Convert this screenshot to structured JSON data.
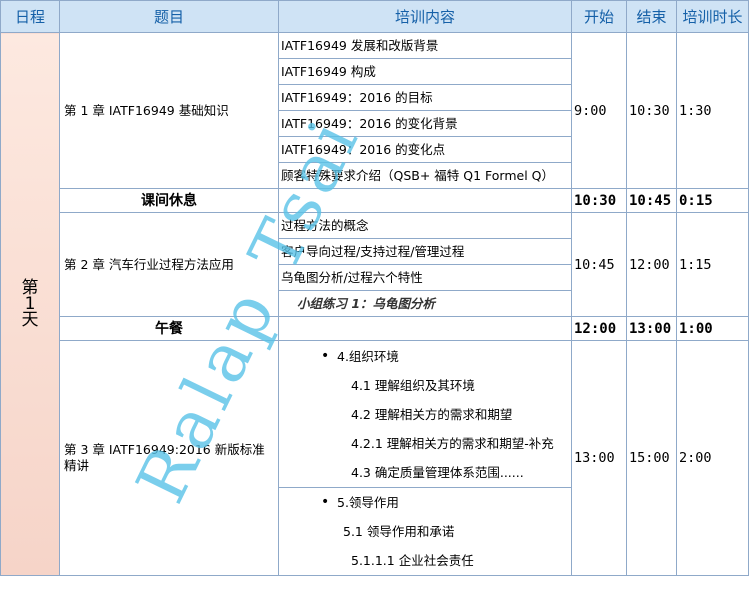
{
  "headers": [
    "日程",
    "题目",
    "培训内容",
    "开始",
    "结束",
    "培训时长"
  ],
  "day": {
    "line1": "第",
    "line2": "1",
    "line3": "天"
  },
  "ch1": {
    "topic": "第 1 章  IATF16949 基础知识",
    "items": [
      "IATF16949 发展和改版背景",
      "IATF16949 构成",
      "IATF16949：2016  的目标",
      "IATF16949：2016 的变化背景",
      "IATF16949：2016  的变化点",
      "顾客特殊要求介绍（QSB+  福特 Q1 Formel Q）"
    ],
    "start": "9:00",
    "end": "10:30",
    "duration": "1:30"
  },
  "break1": {
    "label": "课间休息",
    "start": "10:30",
    "end": "10:45",
    "duration": "0:15"
  },
  "ch2": {
    "topic": "第 2 章  汽车行业过程方法应用",
    "items": [
      "过程方法的概念",
      "客户导向过程/支持过程/管理过程",
      "乌龟图分析/过程六个特性"
    ],
    "exercise": "小组练习 1：乌龟图分析",
    "start": "10:45",
    "end": "12:00",
    "duration": "1:15"
  },
  "lunch": {
    "label": "午餐",
    "start": "12:00",
    "end": "13:00",
    "duration": "1:00"
  },
  "ch3": {
    "topic": "第 3 章  IATF16949:2016 新版标准精讲",
    "block1": {
      "bullet": "4.组织环境",
      "items": [
        "4.1 理解组织及其环境",
        "4.2  理解相关方的需求和期望",
        "4.2.1 理解相关方的需求和期望-补充",
        "4.3  确定质量管理体系范围......"
      ]
    },
    "block2": {
      "bullet": "5.领导作用",
      "items": [
        "5.1  领导作用和承诺",
        "5.1.1.1 企业社会责任"
      ]
    },
    "start": "13:00",
    "end": "15:00",
    "duration": "2:00"
  },
  "watermark": "Ralap Tsai",
  "colors": {
    "header_bg": "#cfe3f5",
    "header_text": "#1560a8",
    "border": "#8fa9c9",
    "day_bg": "#f6d4c8",
    "watermark": "#59c3e8"
  }
}
